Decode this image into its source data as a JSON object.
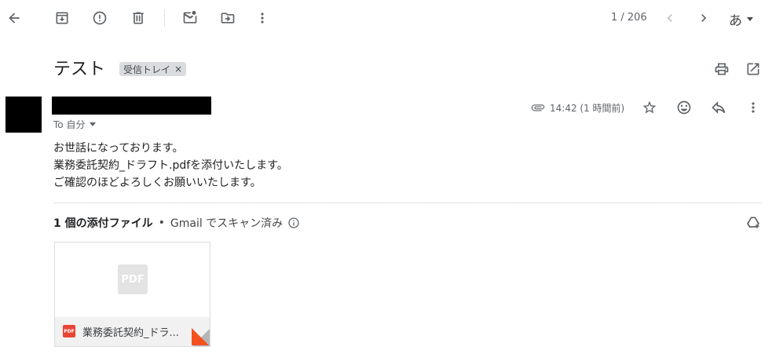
{
  "toolbar": {
    "back_icon": "arrow-back-icon",
    "archive_icon": "archive-icon",
    "spam_icon": "report-spam-icon",
    "delete_icon": "delete-icon",
    "mark_unread_icon": "mark-unread-icon",
    "move_icon": "move-to-icon",
    "more_icon": "more-vert-icon",
    "pager_text": "1 / 206",
    "language_label": "あ"
  },
  "email": {
    "subject": "テスト",
    "label_chip": "受信トレイ",
    "label_remove": "×",
    "to_line": "To 自分",
    "time": "14:42 (1 時間前)",
    "body_lines": [
      "お世話になっております。",
      "業務委託契約_ドラフト.pdfを添付いたします。",
      "ご確認のほどよろしくお願いいたします。"
    ]
  },
  "attachments": {
    "count_label": "1 個の添付ファイル",
    "separator": "•",
    "scan_label": "Gmail でスキャン済み",
    "file_name": "業務委託契約_ドラ...",
    "preview_label": "PDF",
    "badge_label": "PDF"
  },
  "colors": {
    "icon_grey": "#5f6368",
    "pdf_red": "#ea4335",
    "corner_orange": "#f4511e"
  }
}
